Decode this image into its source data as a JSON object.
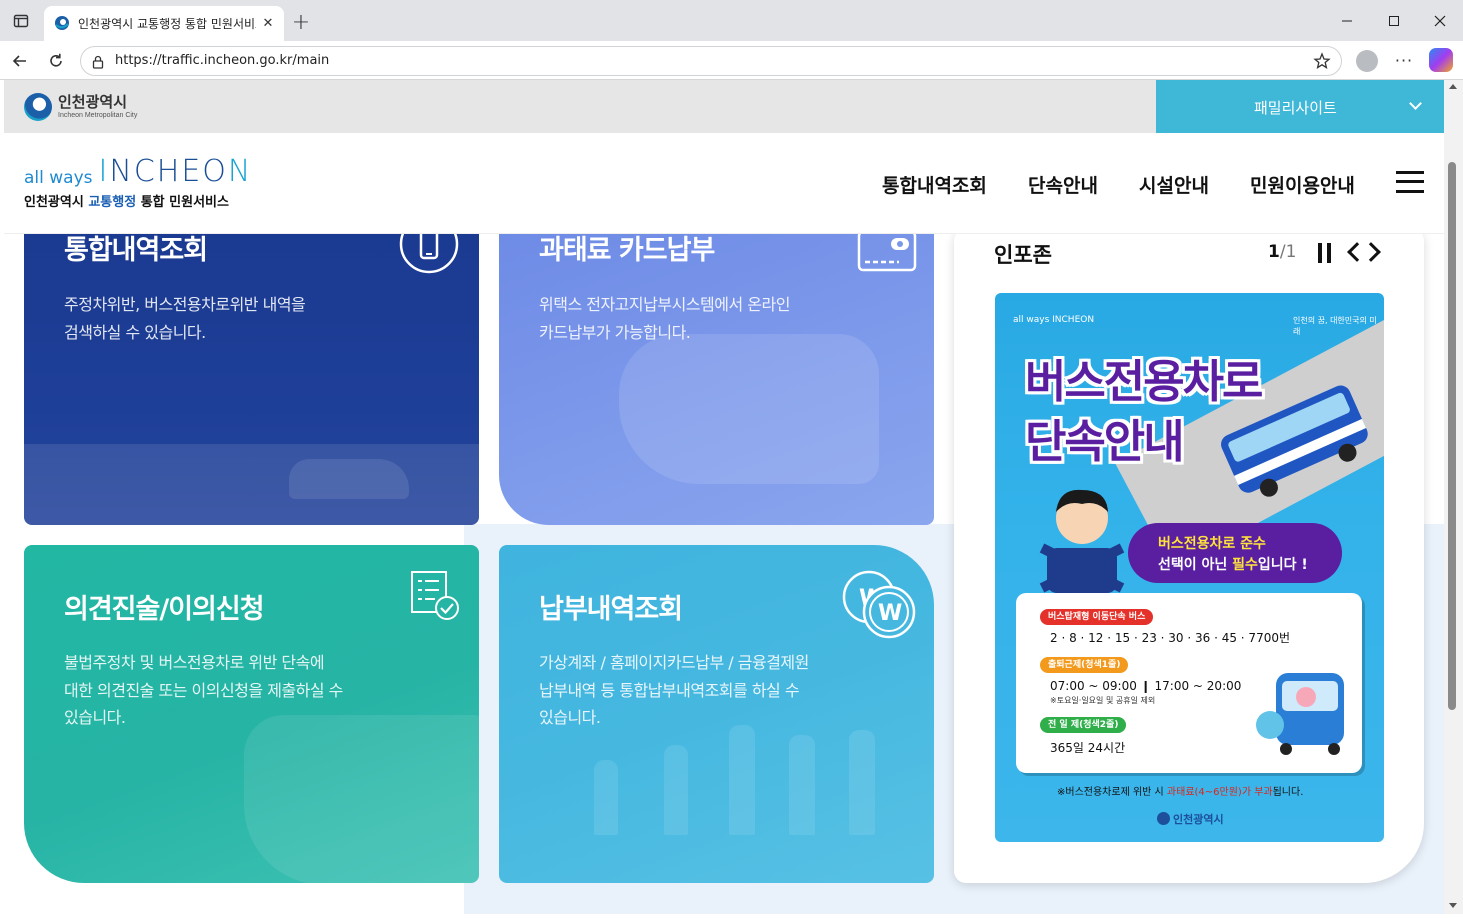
{
  "browser": {
    "tab_title": "인천광역시 교통행정 통합 민원서비스",
    "url": "https://traffic.incheon.go.kr/main",
    "new_tab": "+",
    "close_tab": "✕"
  },
  "site": {
    "city_logo_ko": "인천광역시",
    "city_logo_en": "Incheon Metropolitan City",
    "family_site": "패밀리사이트",
    "brand_allways": "all ways",
    "brand_incheon_1": "I",
    "brand_incheon_2": "NCHEO",
    "brand_incheon_3": "N",
    "brand_sub_1": "인천광역시 ",
    "brand_sub_hl": "교통행정",
    "brand_sub_2": " 통합 민원서비스"
  },
  "nav": [
    "통합내역조회",
    "단속안내",
    "시설안내",
    "민원이용안내"
  ],
  "cards": [
    {
      "title": "통합내역조회",
      "desc1": "주정차위반, 버스전용차로위반 내역을",
      "desc2": "검색하실 수 있습니다.",
      "icon": "mobile-icon"
    },
    {
      "title": "과태료 카드납부",
      "desc1": "위택스 전자고지납부시스템에서 온라인",
      "desc2": "카드납부가 가능합니다.",
      "icon": "card-icon"
    },
    {
      "title": "의견진술/이의신청",
      "desc1": "불법주정차 및 버스전용차로 위반 단속에",
      "desc2": "대한 의견진술 또는 이의신청을 제출하실 수",
      "desc3": "있습니다.",
      "icon": "checklist-icon"
    },
    {
      "title": "납부내역조회",
      "desc1": "가상계좌 / 홈페이지카드납부 / 금융결제원",
      "desc2": "납부내역 등 통합납부내역조회를 하실 수",
      "desc3": "있습니다.",
      "icon": "won-coin-icon"
    }
  ],
  "infozone": {
    "title": "인포존",
    "page_current": "1",
    "page_sep": "/",
    "page_total": "1"
  },
  "poster": {
    "brand": "all ways INCHEON",
    "city": "인천의 꿈, 대한민국의 미래",
    "title_1": "버스전용차로",
    "title_2": "단속안내",
    "bubble_1": "버스전용차로 준수",
    "bubble_2a": "선택이 아닌 ",
    "bubble_2b": "필수",
    "bubble_2c": "입니다 !",
    "pill_1": "버스탑재형 이동단속 버스",
    "routes": "2 · 8 · 12 · 15 · 23 · 30 · 36 · 45 · 7700번",
    "pill_2": "출퇴근제(청색1줄)",
    "times": "07:00 ~ 09:00  ❙  17:00 ~ 20:00",
    "times_note": "※토요일·일요일 및 공휴일 제외",
    "pill_3": "전 일 제(청색2줄)",
    "allday": "365일 24시간",
    "foot_1": "※버스전용차로제 위반 시 ",
    "foot_red": "과태료(4~6만원)가 부과",
    "foot_2": "됩니다.",
    "logo": "인천광역시"
  },
  "colors": {
    "family_bg": "#3fb7d7",
    "card1": "#1e3f98",
    "card2": "#7b97ea",
    "card3": "#26b4a5",
    "card4": "#46b8e0",
    "poster_title": "#5a1fa0"
  }
}
